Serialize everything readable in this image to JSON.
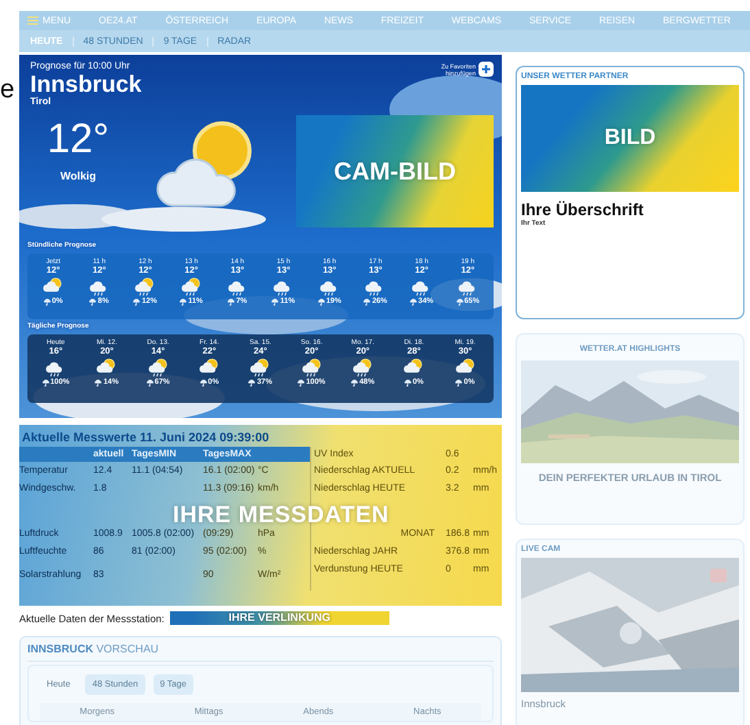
{
  "edge_fragment": "e",
  "nav": [
    {
      "label": "MENU",
      "kind": "menu"
    },
    {
      "label": "OE24.AT",
      "kind": "link"
    },
    {
      "label": "ÖSTERREICH",
      "kind": "link"
    },
    {
      "label": "EUROPA",
      "kind": "link"
    },
    {
      "label": "NEWS",
      "kind": "link"
    },
    {
      "label": "FREIZEIT",
      "kind": "link"
    },
    {
      "label": "WEBCAMS",
      "kind": "link"
    },
    {
      "label": "SERVICE",
      "kind": "link"
    },
    {
      "label": "REISEN",
      "kind": "link"
    },
    {
      "label": "BERGWETTER",
      "kind": "link"
    }
  ],
  "subtabs": [
    {
      "label": "HEUTE",
      "selected": true
    },
    {
      "label": "48 STUNDEN",
      "selected": false
    },
    {
      "label": "9 TAGE",
      "selected": false
    },
    {
      "label": "RADAR",
      "selected": false
    }
  ],
  "hero": {
    "subtitle": "Prognose für 10:00 Uhr",
    "city": "Innsbruck",
    "region": "Tirol",
    "temperature": "12°",
    "condition": "Wolkig",
    "favorite": "Zu Favoriten hinzufügen",
    "cam_label": "CAM-BILD",
    "hourly_title": "Stündliche Prognose",
    "hourly": [
      {
        "time": "Jetzt",
        "temp": "12°",
        "kind": "sun-cloud",
        "precip": "0%"
      },
      {
        "time": "11 h",
        "temp": "12°",
        "kind": "cloud-rain",
        "precip": "8%"
      },
      {
        "time": "12 h",
        "temp": "12°",
        "kind": "sun-cloud-rain",
        "precip": "12%"
      },
      {
        "time": "13 h",
        "temp": "12°",
        "kind": "sun-cloud-rain",
        "precip": "11%"
      },
      {
        "time": "14 h",
        "temp": "13°",
        "kind": "cloud-rain",
        "precip": "7%"
      },
      {
        "time": "15 h",
        "temp": "13°",
        "kind": "cloud-rain",
        "precip": "11%"
      },
      {
        "time": "16 h",
        "temp": "13°",
        "kind": "cloud-rain",
        "precip": "19%"
      },
      {
        "time": "17 h",
        "temp": "13°",
        "kind": "cloud-rain",
        "precip": "26%"
      },
      {
        "time": "18 h",
        "temp": "12°",
        "kind": "cloud-rain",
        "precip": "34%"
      },
      {
        "time": "19 h",
        "temp": "12°",
        "kind": "cloud-rain",
        "precip": "65%"
      }
    ],
    "daily_title": "Tägliche Prognose",
    "daily": [
      {
        "time": "Heute",
        "temp": "16°",
        "kind": "cloud-rain",
        "precip": "100%"
      },
      {
        "time": "Mi. 12.",
        "temp": "20°",
        "kind": "sun-cloud",
        "precip": "14%"
      },
      {
        "time": "Do. 13.",
        "temp": "14°",
        "kind": "sun-cloud-rain",
        "precip": "67%"
      },
      {
        "time": "Fr. 14.",
        "temp": "22°",
        "kind": "sun-cloud",
        "precip": "0%"
      },
      {
        "time": "Sa. 15.",
        "temp": "24°",
        "kind": "sun-cloud-rain",
        "precip": "37%"
      },
      {
        "time": "So. 16.",
        "temp": "20°",
        "kind": "sun-cloud-rain",
        "precip": "100%"
      },
      {
        "time": "Mo. 17.",
        "temp": "20°",
        "kind": "sun-cloud-rain",
        "precip": "48%"
      },
      {
        "time": "Di. 18.",
        "temp": "28°",
        "kind": "sun-cloud",
        "precip": "0%"
      },
      {
        "time": "Mi. 19.",
        "temp": "30°",
        "kind": "sun-cloud",
        "precip": "0%"
      }
    ]
  },
  "measurements": {
    "title": "Aktuelle Messwerte 11. Juni 2024 09:39:00",
    "overlay": "IHRE MESSDATEN",
    "columns": [
      "aktuell",
      "TagesMIN",
      "TagesMAX"
    ],
    "rows": [
      {
        "label": "Temperatur",
        "current": "12.4",
        "min": "11.1 (04:54)",
        "max": "16.1 (02:00)",
        "unit": "°C"
      },
      {
        "label": "Windgeschw.",
        "current": "1.8",
        "max": "11.3 (09:16)",
        "unit": "km/h"
      },
      {
        "label": "Luftdruck",
        "current": "1008.9",
        "min": "1005.8 (02:00)",
        "max": "(09:29)",
        "unit": "hPa"
      },
      {
        "label": "Luftfeuchte",
        "current": "86",
        "min": "81 (02:00)",
        "max": "95 (02:00)",
        "unit": "%"
      },
      {
        "label": "Solarstrahlung",
        "current": "83",
        "max": "90",
        "unit": "W/m²"
      }
    ],
    "extra_rows": [
      {
        "label": "UV Index",
        "value": "0.6"
      },
      {
        "label": "Niederschlag AKTUELL",
        "value": "0.2",
        "unit": "mm/h"
      },
      {
        "label": "Niederschlag HEUTE",
        "value": "3.2",
        "unit": "mm"
      },
      {
        "label": "MONAT",
        "value": "186.8",
        "unit": "mm"
      },
      {
        "label": "Niederschlag JAHR",
        "value": "376.8",
        "unit": "mm"
      },
      {
        "label": "Verdunstung HEUTE",
        "value": "0",
        "unit": "mm"
      }
    ]
  },
  "station": {
    "label": "Aktuelle Daten der Messstation:",
    "link": "IHRE VERLINKUNG"
  },
  "preview": {
    "title": "**INNSBRUCK** VORSCHAU",
    "tabs": [
      {
        "label": "Heute",
        "selected": true
      },
      {
        "label": "48 Stunden",
        "selected": false
      },
      {
        "label": "9 Tage",
        "selected": false
      }
    ],
    "columns": [
      "Morgens",
      "Mittags",
      "Abends",
      "Nachts"
    ]
  },
  "partner": {
    "heading": "UNSER WETTER PARTNER",
    "image_label": "BILD",
    "title": "Ihre Überschrift",
    "text": "Ihr Text"
  },
  "highlights": {
    "heading": "WETTER.AT HIGHLIGHTS",
    "caption": "DEIN PERFEKTER URLAUB IN TIROL"
  },
  "livecam": {
    "heading": "LIVE CAM",
    "caption": "Innsbruck"
  }
}
